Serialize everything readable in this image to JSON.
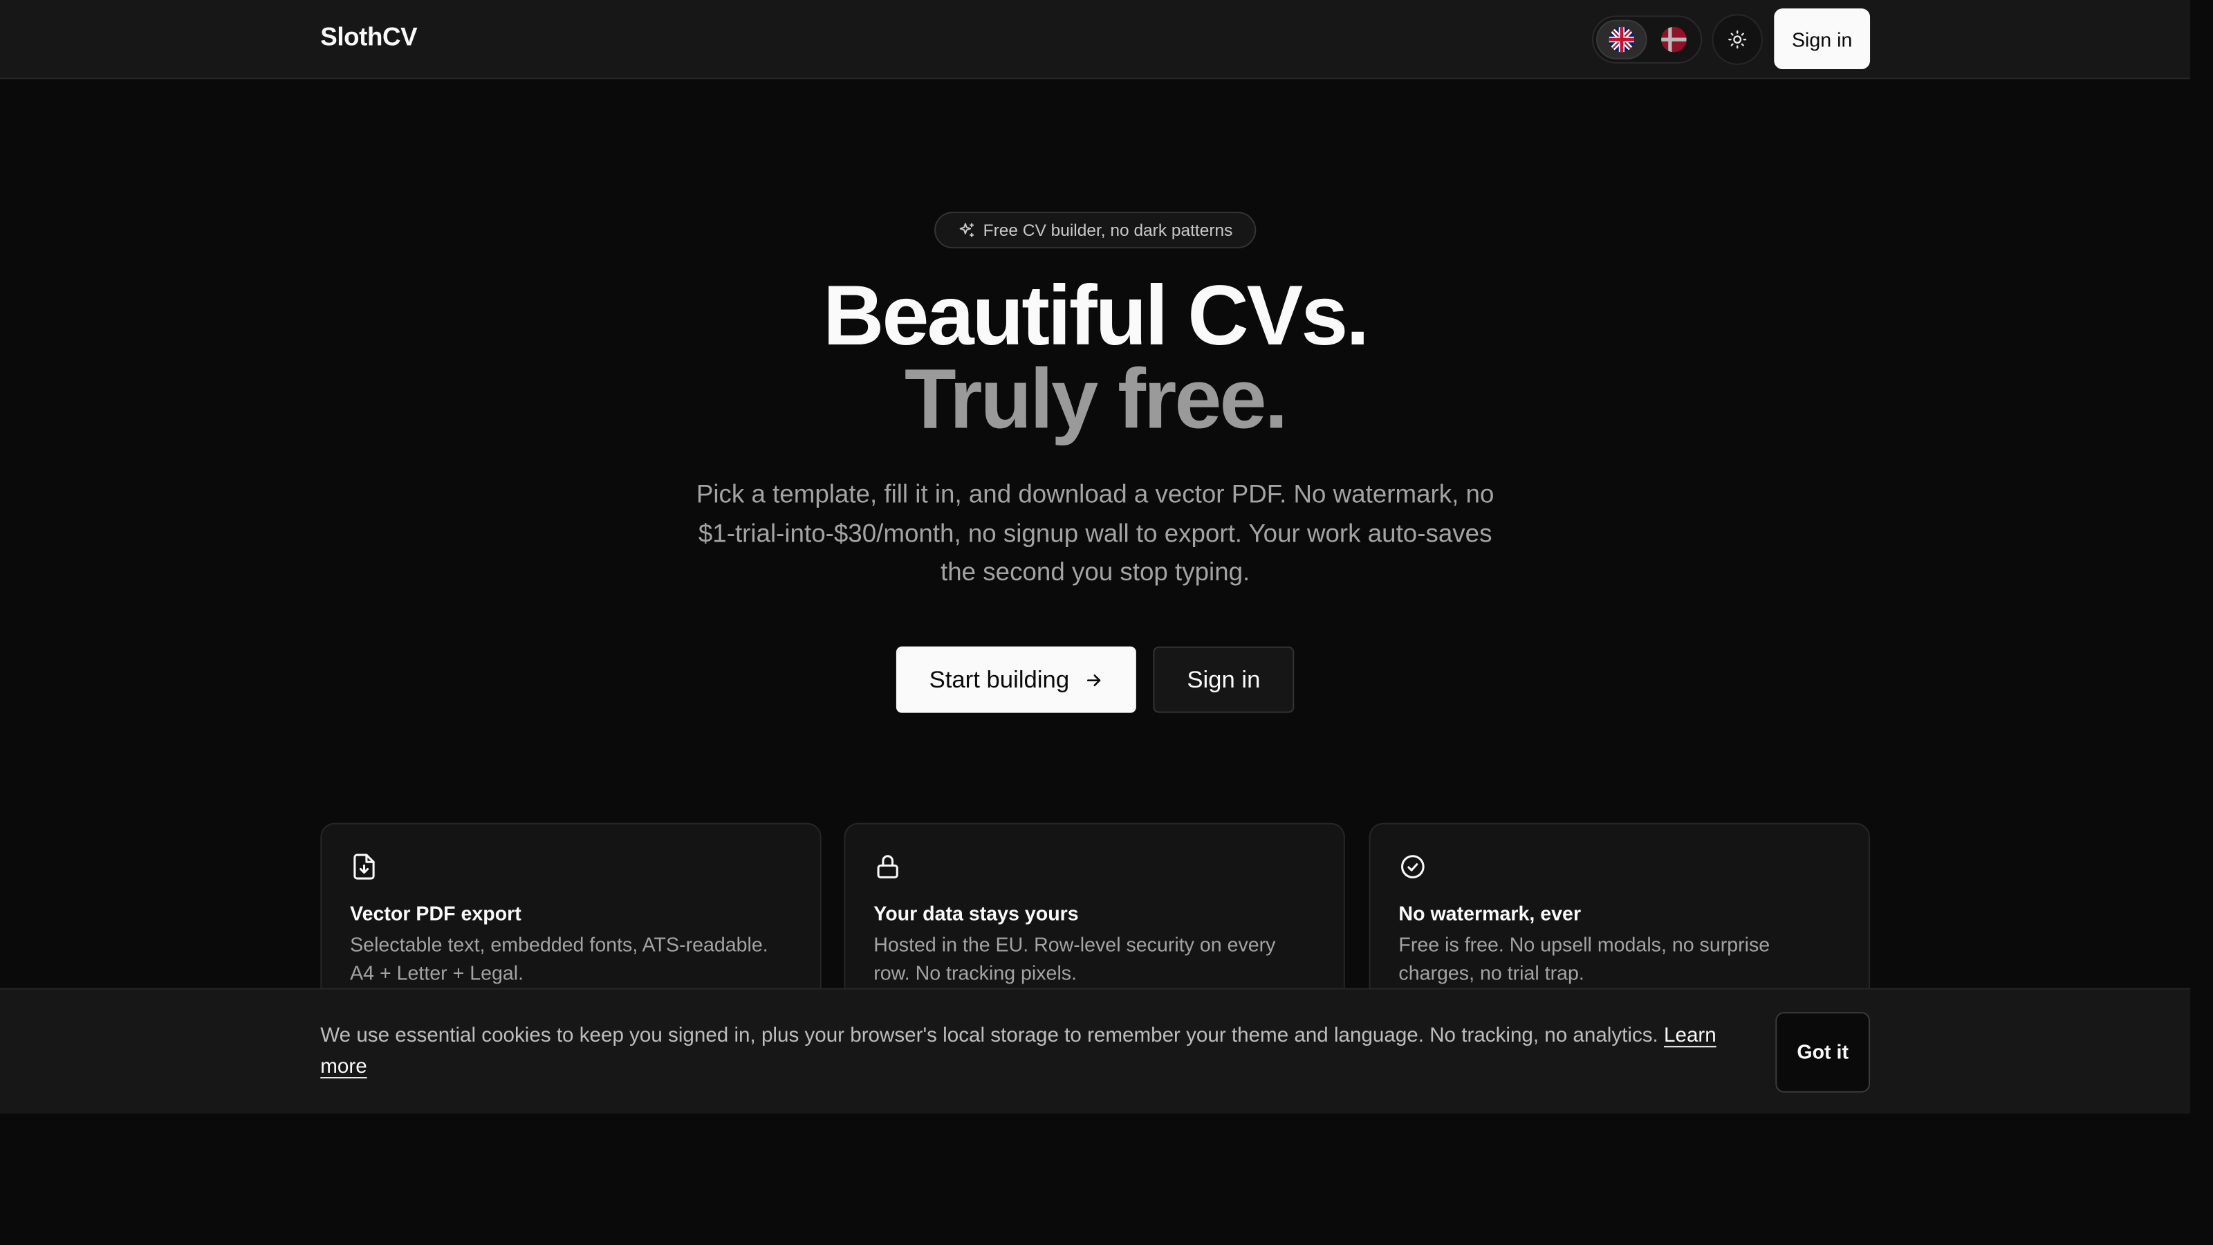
{
  "header": {
    "brand": "SlothCV",
    "languages": [
      {
        "code": "en",
        "label": "English",
        "active": true
      },
      {
        "code": "da",
        "label": "Dansk",
        "active": false
      }
    ],
    "theme_icon": "sun-icon",
    "signin_label": "Sign in"
  },
  "hero": {
    "badge": "Free CV builder, no dark patterns",
    "badge_icon": "sparkles-icon",
    "title_line1": "Beautiful CVs.",
    "title_line2": "Truly free.",
    "subtitle": "Pick a template, fill it in, and download a vector PDF. No watermark, no $1-trial-into-$30/month, no signup wall to export. Your work auto-saves the second you stop typing.",
    "cta_primary": "Start building",
    "cta_primary_icon": "arrow-right-icon",
    "cta_secondary": "Sign in"
  },
  "features": [
    {
      "icon": "file-download-icon",
      "title": "Vector PDF export",
      "text": "Selectable text, embedded fonts, ATS-readable. A4 + Letter + Legal."
    },
    {
      "icon": "lock-icon",
      "title": "Your data stays yours",
      "text": "Hosted in the EU. Row-level security on every row. No tracking pixels."
    },
    {
      "icon": "check-circle-icon",
      "title": "No watermark, ever",
      "text": "Free is free. No upsell modals, no surprise charges, no trial trap."
    }
  ],
  "cookie": {
    "text": "We use essential cookies to keep you signed in, plus your browser's local storage to remember your theme and language. No tracking, no analytics.",
    "link": "Learn more",
    "button": "Got it"
  },
  "colors": {
    "background": "#0a0a0a",
    "surface": "#171717",
    "primary": "#fafafa",
    "muted": "#a3a3a3"
  }
}
